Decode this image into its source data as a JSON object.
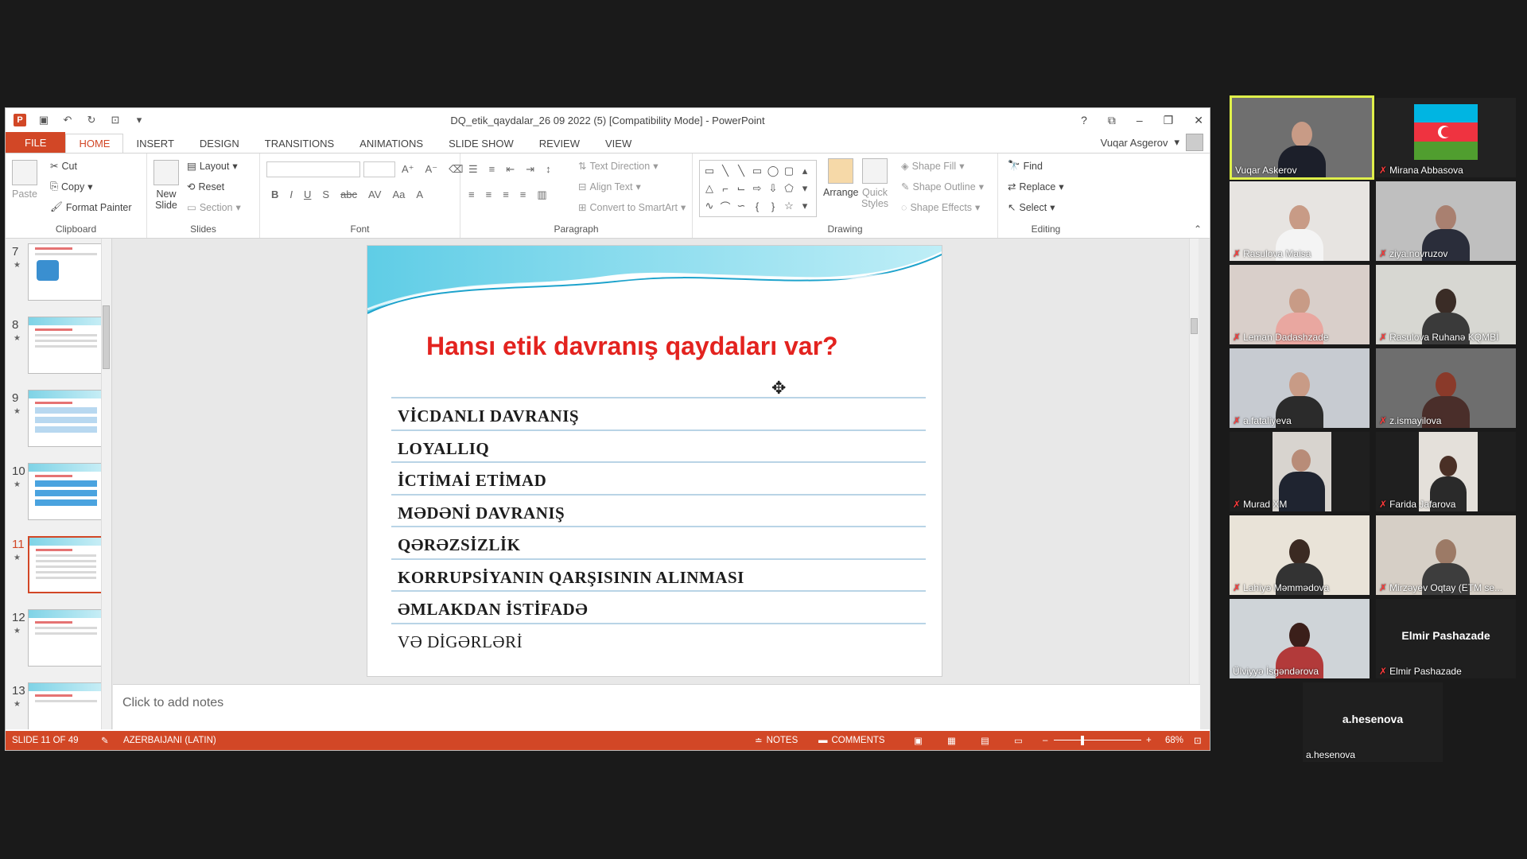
{
  "window": {
    "title": "DQ_etik_qaydalar_26 09 2022 (5) [Compatibility Mode] - PowerPoint",
    "user": "Vuqar Asgerov"
  },
  "tabs": [
    "FILE",
    "HOME",
    "INSERT",
    "DESIGN",
    "TRANSITIONS",
    "ANIMATIONS",
    "SLIDE SHOW",
    "REVIEW",
    "VIEW"
  ],
  "ribbon": {
    "clipboard": {
      "label": "Clipboard",
      "paste": "Paste",
      "cut": "Cut",
      "copy": "Copy",
      "format_painter": "Format Painter"
    },
    "slides": {
      "label": "Slides",
      "new_slide_1": "New",
      "new_slide_2": "Slide",
      "layout": "Layout",
      "reset": "Reset",
      "section": "Section"
    },
    "font": {
      "label": "Font"
    },
    "paragraph": {
      "label": "Paragraph",
      "text_direction": "Text Direction",
      "align_text": "Align Text",
      "convert": "Convert to SmartArt"
    },
    "drawing": {
      "label": "Drawing",
      "arrange": "Arrange",
      "quick_1": "Quick",
      "quick_2": "Styles",
      "shape_fill": "Shape Fill",
      "shape_outline": "Shape Outline",
      "shape_effects": "Shape Effects"
    },
    "editing": {
      "label": "Editing",
      "find": "Find",
      "replace": "Replace",
      "select": "Select"
    }
  },
  "thumbnails": [
    {
      "num": "7"
    },
    {
      "num": "8"
    },
    {
      "num": "9"
    },
    {
      "num": "10"
    },
    {
      "num": "11"
    },
    {
      "num": "12"
    },
    {
      "num": "13"
    }
  ],
  "slide": {
    "title": "Hansı etik davranış qaydaları var?",
    "rules": [
      "VİCDANLI DAVRANIŞ",
      "LOYALLIQ",
      "İCTİMAİ ETİMAD",
      "MƏDƏNİ DAVRANIŞ",
      "QƏRƏZSİZLİK",
      "KORRUPSİYANIN QARŞISININ ALINMASI",
      "ƏMLAKDAN İSTİFADƏ",
      "VƏ  DİGƏRLƏRİ"
    ]
  },
  "notes_placeholder": "Click to add notes",
  "status": {
    "slide": "SLIDE 11 OF 49",
    "language": "AZERBAIJANI (LATIN)",
    "notes": "NOTES",
    "comments": "COMMENTS",
    "zoom": "68%"
  },
  "participants": [
    {
      "name": "Vuqar Askerov",
      "muted": false
    },
    {
      "name": "Mirana Abbasova",
      "muted": true
    },
    {
      "name": "Rasulova Maisa",
      "muted": true
    },
    {
      "name": "ziya.novruzov",
      "muted": true
    },
    {
      "name": "Leman Dadashzade",
      "muted": true
    },
    {
      "name": "Rasulova Ruhanə KQMBİ",
      "muted": true
    },
    {
      "name": "a.fataliyeva",
      "muted": true
    },
    {
      "name": "z.ismayilova",
      "muted": true
    },
    {
      "name": "Murad XM",
      "muted": true
    },
    {
      "name": "Farida Jafarova",
      "muted": true
    },
    {
      "name": "Lahiyə Məmmədova",
      "muted": true
    },
    {
      "name": "Mirzəyev Oqtay (ETM se...",
      "muted": true
    },
    {
      "name": "Ülviyyə İsgəndərova",
      "muted": false
    },
    {
      "name": "Elmir Pashazade",
      "muted": true,
      "display": "Elmir Pashazade"
    },
    {
      "name": "a.hesenova",
      "muted": false,
      "display": "a.hesenova"
    }
  ],
  "colors": {
    "accent": "#d24726",
    "title_red": "#e3231f",
    "speaker_border": "#dff04a"
  }
}
